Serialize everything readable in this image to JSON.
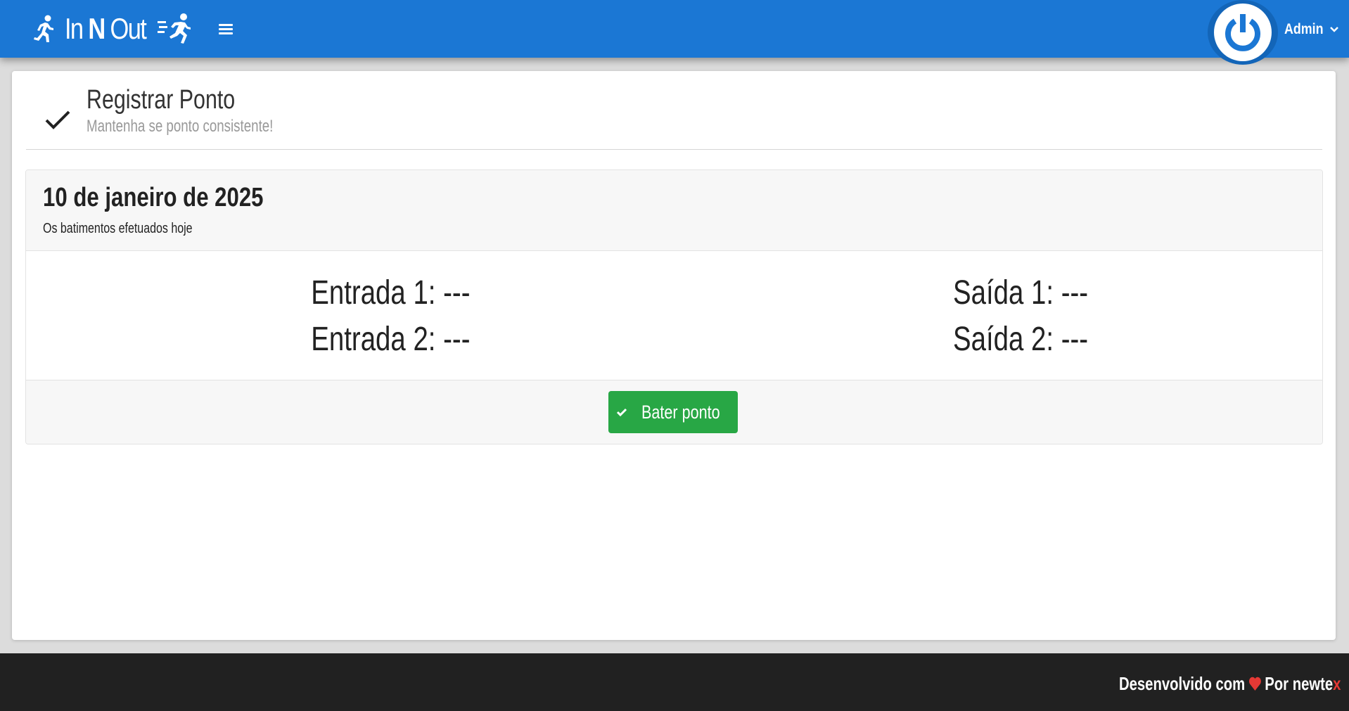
{
  "header": {
    "brand_prefix": "In ",
    "brand_mid": "N",
    "brand_suffix": " Out",
    "user_name": "Admin"
  },
  "page": {
    "title": "Registrar Ponto",
    "subtitle": "Mantenha se ponto consistente!"
  },
  "panel": {
    "date": "10 de janeiro de 2025",
    "description": "Os batimentos efetuados hoje",
    "records": {
      "entrada1": "Entrada 1: ---",
      "entrada2": "Entrada 2: ---",
      "saida1": "Saída 1: ---",
      "saida2": "Saída 2: ---"
    },
    "button_label": "Bater ponto"
  },
  "footer": {
    "text_before": "Desenvolvido com",
    "text_after": "Por newte",
    "text_accent": "x"
  },
  "icons": {
    "brand_left": "running-person-icon",
    "brand_right": "running-fast-icon",
    "menu": "hamburger-menu-icon",
    "avatar": "power-icon",
    "dropdown": "chevron-down-icon",
    "page": "check-icon",
    "button": "check-icon",
    "footer": "heart-icon"
  },
  "colors": {
    "header_bg": "#1b77d4",
    "avatar_ring": "#1365b8",
    "button_bg": "#28a745",
    "footer_bg": "#212121",
    "accent_red": "#e53935"
  }
}
